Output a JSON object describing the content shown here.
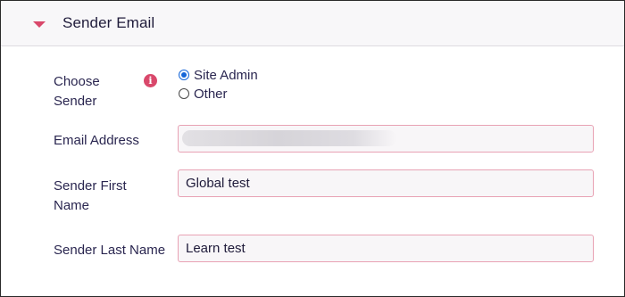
{
  "section": {
    "title": "Sender Email"
  },
  "choose_sender": {
    "label_line1": "Choose",
    "label_line2": "Sender",
    "options": [
      {
        "label": "Site Admin",
        "selected": true
      },
      {
        "label": "Other",
        "selected": false
      }
    ]
  },
  "email_address": {
    "label": "Email Address",
    "value": ""
  },
  "sender_first_name": {
    "label_line1": "Sender First",
    "label_line2": "Name",
    "value": "Global test"
  },
  "sender_last_name": {
    "label": "Sender Last Name",
    "value": "Learn test"
  },
  "colors": {
    "accent": "#d9486b",
    "radio_selected": "#1565d8",
    "field_border": "#e8a2b4",
    "text": "#2a2650"
  },
  "icons": {
    "toggle": "caret-down-icon",
    "info": "info-icon"
  }
}
